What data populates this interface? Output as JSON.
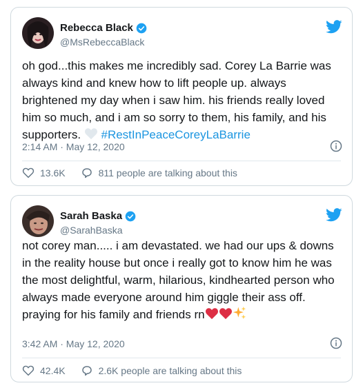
{
  "tweets": [
    {
      "display_name": "Rebecca Black",
      "handle": "@MsRebeccaBlack",
      "text_before_emoji": "oh god...this makes me incredibly sad. Corey La Barrie was always kind and knew how to lift people up. always brightened my day when i saw him. his friends really loved him so much, and i am so sorry to them, his family, and his supporters. ",
      "hashtag": "#RestInPeaceCoreyLaBarrie",
      "timestamp": "2:14 AM · May 12, 2020",
      "likes": "13.6K",
      "talking": "811 people are talking about this"
    },
    {
      "display_name": "Sarah Baska",
      "handle": "@SarahBaska",
      "text": "not corey man..... i am devastated. we had our ups & downs in the reality house but once i really got to know him he was the most delightful, warm, hilarious, kindhearted person who always made everyone around him giggle their ass off. praying for his family and friends rn",
      "timestamp": "3:42 AM · May 12, 2020",
      "likes": "42.4K",
      "talking": "2.6K people are talking about this"
    }
  ],
  "icons": {
    "platform": "twitter-bird-icon",
    "verified": "verified-badge-icon",
    "info": "info-icon",
    "like": "heart-icon",
    "reply": "speech-bubble-icon"
  },
  "colors": {
    "twitter_blue": "#1da1f2",
    "hashtag_blue": "#1b95e0",
    "secondary_text": "#657786",
    "border": "#cfd9de",
    "heart_emoji_red": "#dd2e44",
    "white_heart_emoji": "#e1e8ed"
  }
}
